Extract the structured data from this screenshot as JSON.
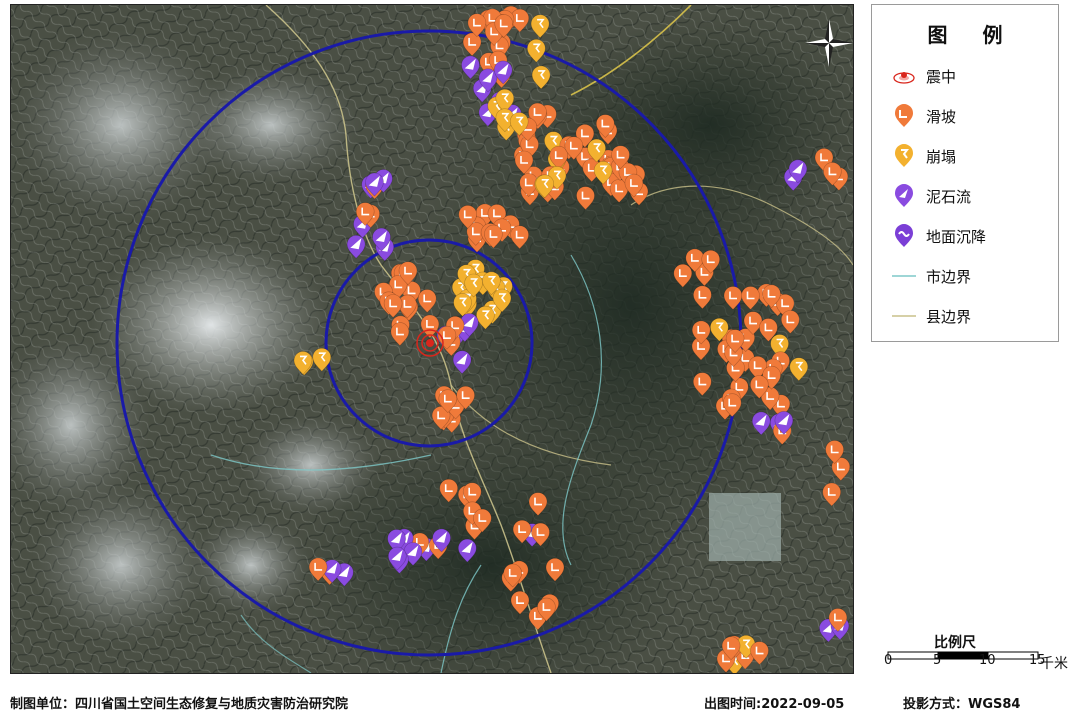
{
  "legend": {
    "title": "图 例",
    "items": [
      {
        "label": "震中",
        "icon": "epicenter-icon"
      },
      {
        "label": "滑坡",
        "icon": "landslide-icon",
        "color": "#f07a3a"
      },
      {
        "label": "崩塌",
        "icon": "collapse-icon",
        "color": "#f3b12f"
      },
      {
        "label": "泥石流",
        "icon": "debris-flow-icon",
        "color": "#8a4be0"
      },
      {
        "label": "地面沉降",
        "icon": "subsidence-icon",
        "color": "#7b3fd6"
      },
      {
        "label": "市边界",
        "icon": "city-boundary-line",
        "color": "#7ec9c9"
      },
      {
        "label": "县边界",
        "icon": "county-boundary-line",
        "color": "#c9c18a"
      }
    ]
  },
  "scale": {
    "title": "比例尺",
    "ticks": [
      "0",
      "5",
      "10",
      "15"
    ],
    "unit": "千米"
  },
  "footer": {
    "producer": "制图单位：四川省国土空间生态修复与地质灾害防治研究院",
    "date": "出图时间:2022-09-05",
    "projection": "投影方式：WGS84"
  },
  "colors": {
    "landslide": "#f07a3a",
    "collapse": "#f3b12f",
    "debris_flow": "#8a4be0",
    "subsidence": "#7b3fd6",
    "buffer_ring": "#1a1aa8",
    "epicenter": "#d9261c",
    "city_boundary": "#7ec9c9",
    "county_boundary": "#c9c18a"
  }
}
